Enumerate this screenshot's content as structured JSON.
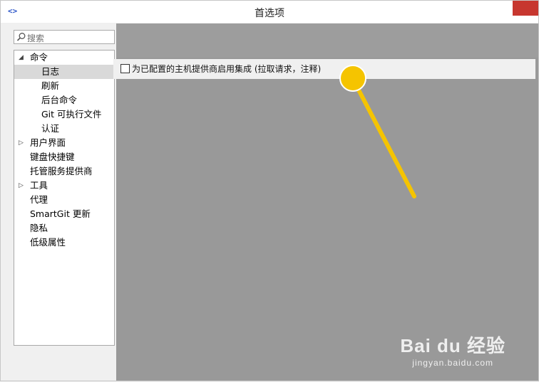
{
  "window": {
    "title": "首选项"
  },
  "search": {
    "placeholder": "搜索"
  },
  "tree": {
    "items": [
      {
        "label": "命令",
        "expanded": true
      },
      {
        "label": "日志",
        "selected": true
      },
      {
        "label": "刷新"
      },
      {
        "label": "后台命令"
      },
      {
        "label": "Git 可执行文件"
      },
      {
        "label": "认证"
      },
      {
        "label": "用户界面",
        "expandable": true
      },
      {
        "label": "键盘快捷键"
      },
      {
        "label": "托管服务提供商"
      },
      {
        "label": "工具",
        "expandable": true
      },
      {
        "label": "代理"
      },
      {
        "label": "SmartGit 更新"
      },
      {
        "label": "隐私"
      },
      {
        "label": "低级属性"
      }
    ]
  },
  "options": {
    "integration_label": "为已配置的主机提供商启用集成 (拉取请求，注释)",
    "integration_checked": false
  },
  "watermark": {
    "brand": "Bai du 经验",
    "url": "jingyan.baidu.com"
  },
  "colors": {
    "callout": "#f5c400",
    "overlay": "#999999",
    "close": "#c7372f"
  },
  "icons": {
    "app": "code-brackets-icon",
    "search": "search-icon",
    "expand": "triangle-right-icon",
    "collapse": "triangle-down-icon"
  }
}
